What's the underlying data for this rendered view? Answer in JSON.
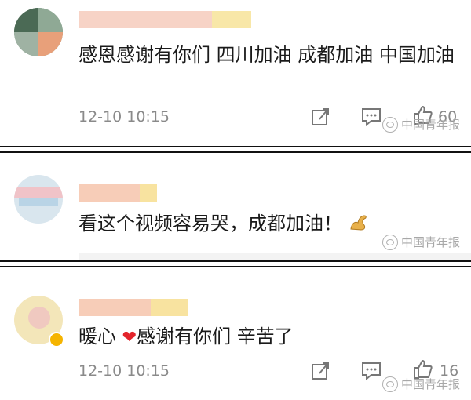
{
  "comments": [
    {
      "text": "感恩感谢有你们 四川加油 成都加油 中国加油",
      "time": "12-10 10:15",
      "like_count": "60",
      "icons": [
        "share-icon",
        "comment-icon",
        "like-icon"
      ]
    },
    {
      "text": "看这个视频容易哭，成都加油！",
      "time": "",
      "like_count": "",
      "emoji": "flexed-biceps"
    },
    {
      "text_before": "暖心 ",
      "text_after": "感谢有你们 辛苦了",
      "time": "12-10 10:15",
      "like_count": "16",
      "emoji": "red-heart"
    }
  ],
  "watermark": "中国青年报",
  "colors": {
    "heart": "#e3242b",
    "watermark": "#a8a8a8",
    "time": "#8a8a8a"
  }
}
